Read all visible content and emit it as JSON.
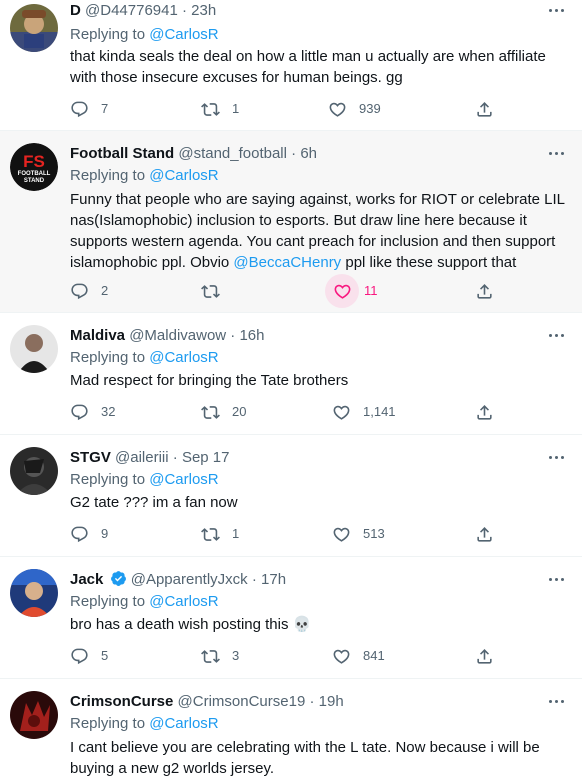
{
  "icons": {
    "reply": "reply-icon",
    "retweet": "retweet-icon",
    "like": "heart-icon",
    "share": "share-icon",
    "more": "more-icon",
    "verified": "verified-badge-icon"
  },
  "colors": {
    "link": "#1d9bf0",
    "like_active": "#f91880",
    "muted": "#536471"
  },
  "tweets": [
    {
      "name": "D",
      "handle": "@D44776941",
      "time": "23h",
      "replying_prefix": "Replying to",
      "replying_to": "@CarlosR",
      "lines": [
        "that kinda seals the deal on how a little man u actually are when affiliate",
        "with those insecure excuses for human beings. gg"
      ],
      "replies": "7",
      "retweets": "1",
      "likes": "939"
    },
    {
      "name": "Football Stand",
      "handle": "@stand_football",
      "time": "6h",
      "replying_prefix": "Replying to",
      "replying_to": "@CarlosR",
      "avatar_text": {
        "top": "FS",
        "bottom1": "FOOTBALL",
        "bottom2": "STAND"
      },
      "lines": [
        "Funny that people who are saying against, works for RIOT or celebrate LIL",
        "nas(Islamophobic) inclusion to esports. But draw line here because it",
        "supports western agenda. You cant preach for inclusion and then support"
      ],
      "last_line_prefix": "islamophobic ppl. Obvio ",
      "mention": "@BeccaCHenry",
      "last_line_suffix": " ppl like these support that",
      "replies": "2",
      "retweets": "",
      "likes": "11",
      "liked": true
    },
    {
      "name": "Maldiva",
      "handle": "@Maldivawow",
      "time": "16h",
      "replying_prefix": "Replying to",
      "replying_to": "@CarlosR",
      "lines": [
        "Mad respect for bringing the Tate brothers"
      ],
      "replies": "32",
      "retweets": "20",
      "likes": "1,141"
    },
    {
      "name": "STGV",
      "handle": "@aileriii",
      "time": "Sep 17",
      "replying_prefix": "Replying to",
      "replying_to": "@CarlosR",
      "lines": [
        "G2 tate ??? im a fan now"
      ],
      "replies": "9",
      "retweets": "1",
      "likes": "513"
    },
    {
      "name": "Jack",
      "handle": "@ApparentlyJxck",
      "time": "17h",
      "verified": true,
      "replying_prefix": "Replying to",
      "replying_to": "@CarlosR",
      "lines": [
        "bro has a death wish posting this 💀"
      ],
      "replies": "5",
      "retweets": "3",
      "likes": "841"
    },
    {
      "name": "CrimsonCurse",
      "handle": "@CrimsonCurse19",
      "time": "19h",
      "replying_prefix": "Replying to",
      "replying_to": "@CarlosR",
      "lines": [
        "I cant believe you are celebrating with the L tate. Now because i will be",
        "buying a new g2 worlds jersey."
      ]
    }
  ]
}
